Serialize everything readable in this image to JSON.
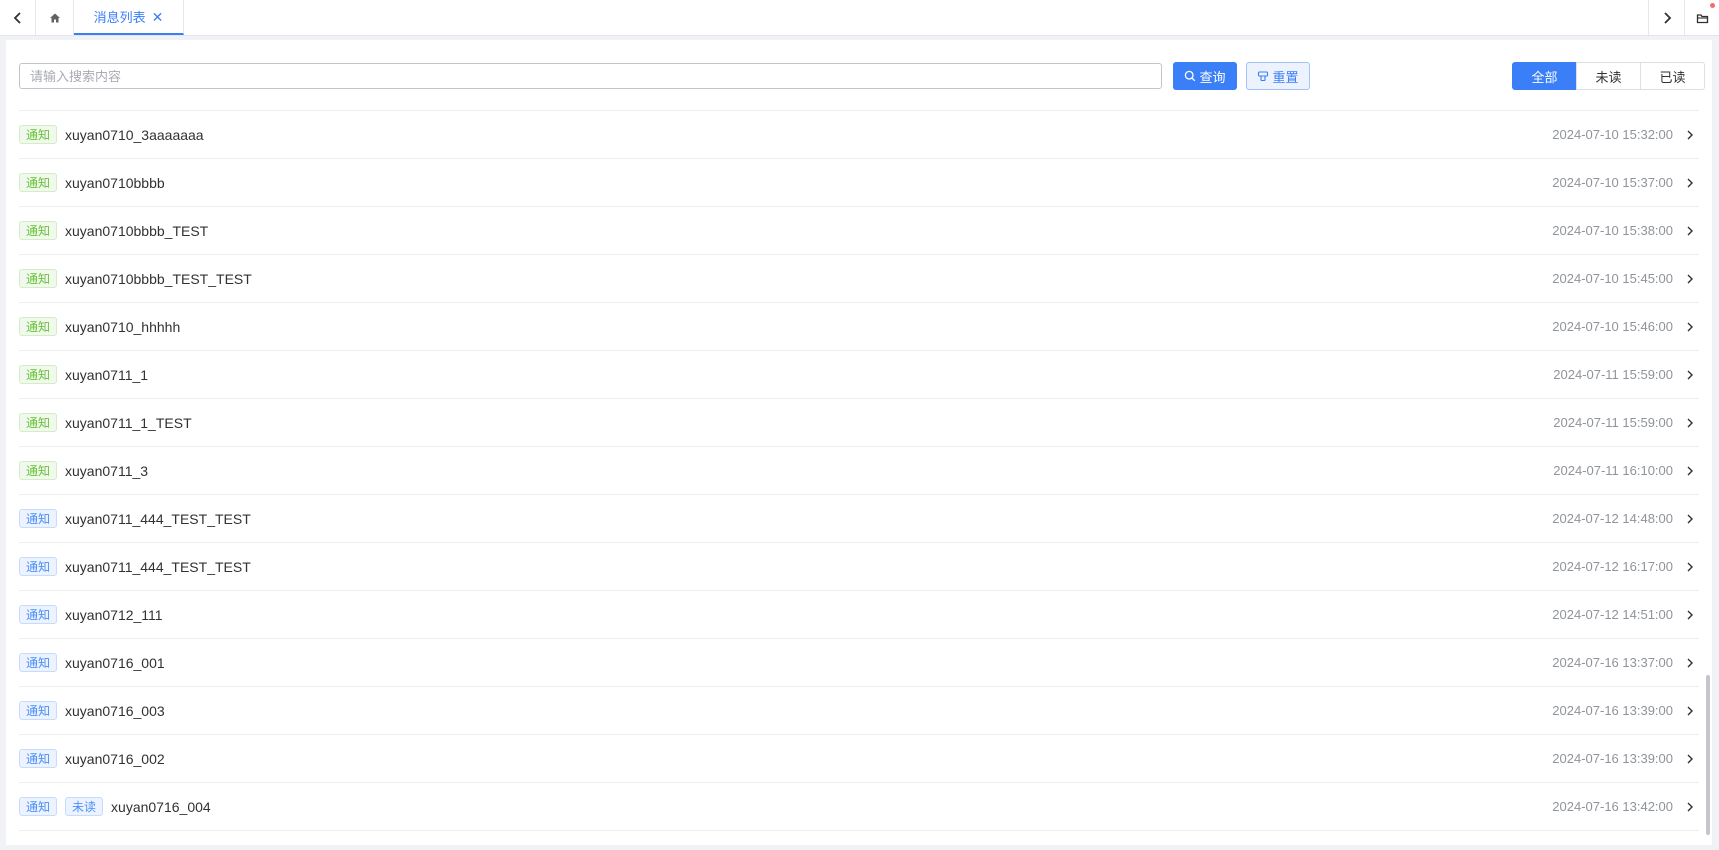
{
  "tabs": {
    "active_label": "消息列表",
    "close_glyph": "✕"
  },
  "toolbar": {
    "search_placeholder": "请输入搜索内容",
    "query_label": "查询",
    "reset_label": "重置"
  },
  "filters": [
    {
      "label": "全部",
      "active": true
    },
    {
      "label": "未读",
      "active": false
    },
    {
      "label": "已读",
      "active": false
    }
  ],
  "messages": [
    {
      "tag": "通知",
      "tag_color": "green",
      "unread": false,
      "title": "xuyan0710_3aaaaaaa",
      "time": "2024-07-10 15:32:00"
    },
    {
      "tag": "通知",
      "tag_color": "green",
      "unread": false,
      "title": "xuyan0710bbbb",
      "time": "2024-07-10 15:37:00"
    },
    {
      "tag": "通知",
      "tag_color": "green",
      "unread": false,
      "title": "xuyan0710bbbb_TEST",
      "time": "2024-07-10 15:38:00"
    },
    {
      "tag": "通知",
      "tag_color": "green",
      "unread": false,
      "title": "xuyan0710bbbb_TEST_TEST",
      "time": "2024-07-10 15:45:00"
    },
    {
      "tag": "通知",
      "tag_color": "green",
      "unread": false,
      "title": "xuyan0710_hhhhh",
      "time": "2024-07-10 15:46:00"
    },
    {
      "tag": "通知",
      "tag_color": "green",
      "unread": false,
      "title": "xuyan0711_1",
      "time": "2024-07-11 15:59:00"
    },
    {
      "tag": "通知",
      "tag_color": "green",
      "unread": false,
      "title": "xuyan0711_1_TEST",
      "time": "2024-07-11 15:59:00"
    },
    {
      "tag": "通知",
      "tag_color": "green",
      "unread": false,
      "title": "xuyan0711_3",
      "time": "2024-07-11 16:10:00"
    },
    {
      "tag": "通知",
      "tag_color": "blue",
      "unread": false,
      "title": "xuyan0711_444_TEST_TEST",
      "time": "2024-07-12 14:48:00"
    },
    {
      "tag": "通知",
      "tag_color": "blue",
      "unread": false,
      "title": "xuyan0711_444_TEST_TEST",
      "time": "2024-07-12 16:17:00"
    },
    {
      "tag": "通知",
      "tag_color": "blue",
      "unread": false,
      "title": "xuyan0712_111",
      "time": "2024-07-12 14:51:00"
    },
    {
      "tag": "通知",
      "tag_color": "blue",
      "unread": false,
      "title": "xuyan0716_001",
      "time": "2024-07-16 13:37:00"
    },
    {
      "tag": "通知",
      "tag_color": "blue",
      "unread": false,
      "title": "xuyan0716_003",
      "time": "2024-07-16 13:39:00"
    },
    {
      "tag": "通知",
      "tag_color": "blue",
      "unread": false,
      "title": "xuyan0716_002",
      "time": "2024-07-16 13:39:00"
    },
    {
      "tag": "通知",
      "tag_color": "blue",
      "unread": true,
      "unread_label": "未读",
      "title": "xuyan0716_004",
      "time": "2024-07-16 13:42:00"
    }
  ],
  "colors": {
    "accent": "#3a7ef8",
    "tag_green": "#67c23a",
    "tag_blue": "#4b8ef9",
    "time_text": "#8f939c",
    "notification_dot": "#f56c6c"
  },
  "icons": {
    "back": "chevron-left-icon",
    "home": "home-icon",
    "forward": "chevron-right-icon",
    "box": "box-icon",
    "search": "search-icon",
    "reset": "reset-icon",
    "row_arrow": "chevron-right-icon"
  }
}
